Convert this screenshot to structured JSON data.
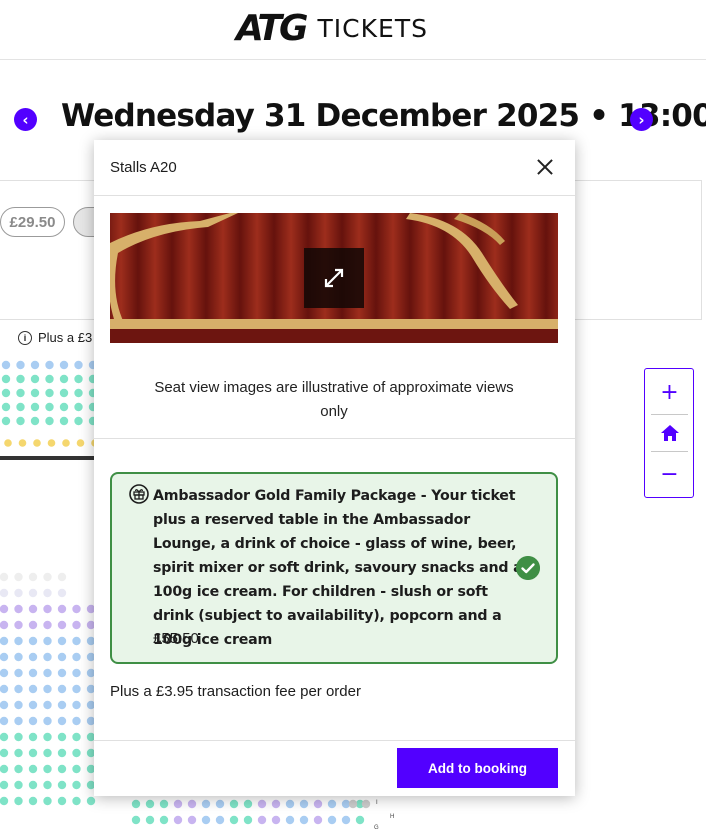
{
  "header": {
    "logo_mark": "ATG",
    "logo_text": "TICKETS"
  },
  "performance": {
    "date_title": "Wednesday 31 December 2025 • 13:00",
    "prev_icon": "chevron-left-icon",
    "next_icon": "chevron-right-icon"
  },
  "background": {
    "price_chip": "£29.50",
    "info_note": "Plus a £3",
    "row_letters": [
      "I",
      "H",
      "G"
    ]
  },
  "zoom_controls": {
    "zoom_in": "+",
    "zoom_out": "−",
    "home_icon": "home-icon"
  },
  "modal": {
    "title": "Stalls A20",
    "close_icon": "close-icon",
    "expand_icon": "expand-icon",
    "seat_note": "Seat view images are illustrative of approximate views only",
    "package": {
      "icon": "gift-icon",
      "description": "Ambassador Gold Family Package - Your ticket plus a reserved table in the Ambassador Lounge, a drink of choice - glass of wine, beer, spirit mixer or soft drink, savoury snacks and a 100g ice cream. For children - slush or soft drink (subject to availability), popcorn and a 100g ice cream",
      "price": "£55.50",
      "selected": true,
      "check_icon": "check-circle-icon"
    },
    "fee_note": "Plus a £3.95 transaction fee per order",
    "add_button": "Add to booking"
  },
  "colors": {
    "accent": "#5200ff",
    "package_border": "#3f8f45",
    "package_bg": "#e8f5e8",
    "seat_mint": "#7fe3c7",
    "seat_blue": "#a9cdf2",
    "seat_purple": "#c8b4f0",
    "seat_gold": "#f5d76e"
  }
}
